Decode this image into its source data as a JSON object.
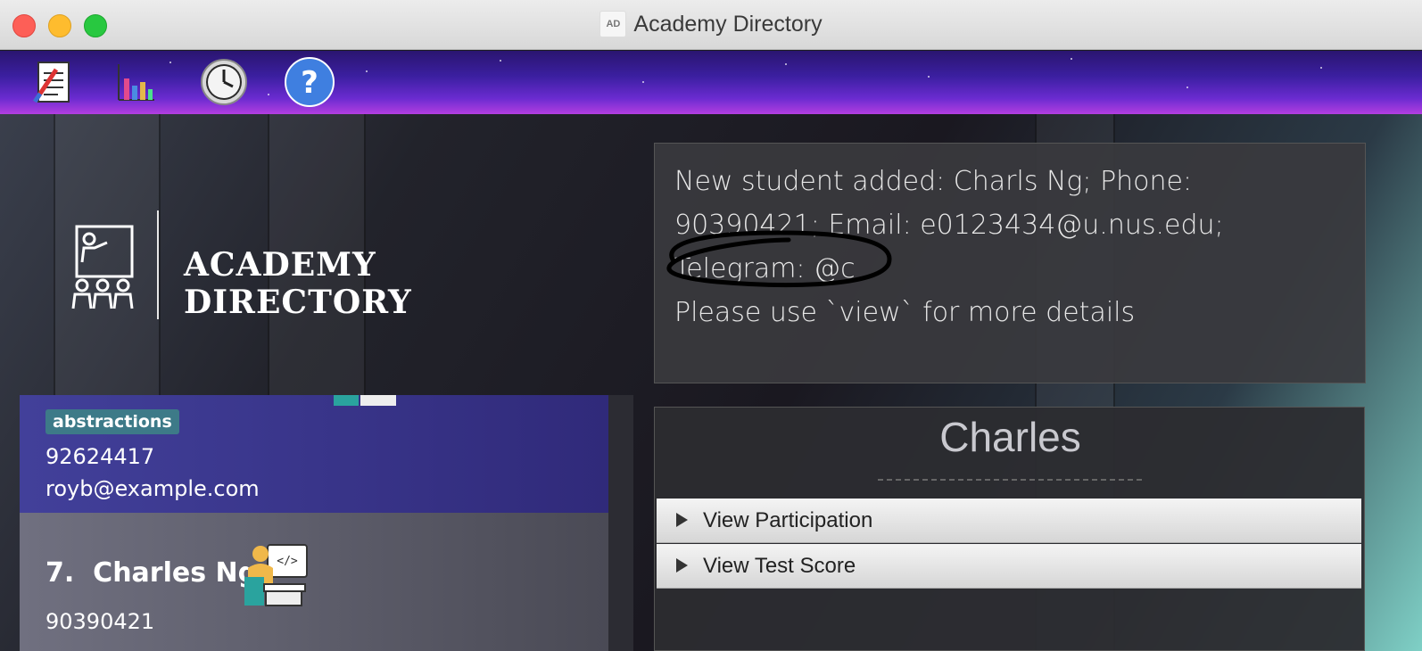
{
  "window": {
    "app_badge": "AD",
    "title": "Academy Directory"
  },
  "toolbar": {
    "icons": [
      "edit-document-icon",
      "chart-icon",
      "clock-icon",
      "help-icon"
    ]
  },
  "logo": {
    "text": "ACADEMY DIRECTORY"
  },
  "result": {
    "lines": [
      "New student added: Charls Ng; Phone:",
      "90390421; Email: e0123434@u.nus.edu;",
      "Telegram: @c",
      "Please use `view` for more details"
    ]
  },
  "student_list": {
    "selected_card": {
      "tag": "abstractions",
      "phone": "92624417",
      "email": "royb@example.com"
    },
    "next_card": {
      "index": "7.",
      "name": "Charles Ng",
      "phone": "90390421"
    }
  },
  "detail": {
    "name": "Charles",
    "sections": [
      {
        "label": "View Participation"
      },
      {
        "label": "View Test Score"
      }
    ]
  }
}
